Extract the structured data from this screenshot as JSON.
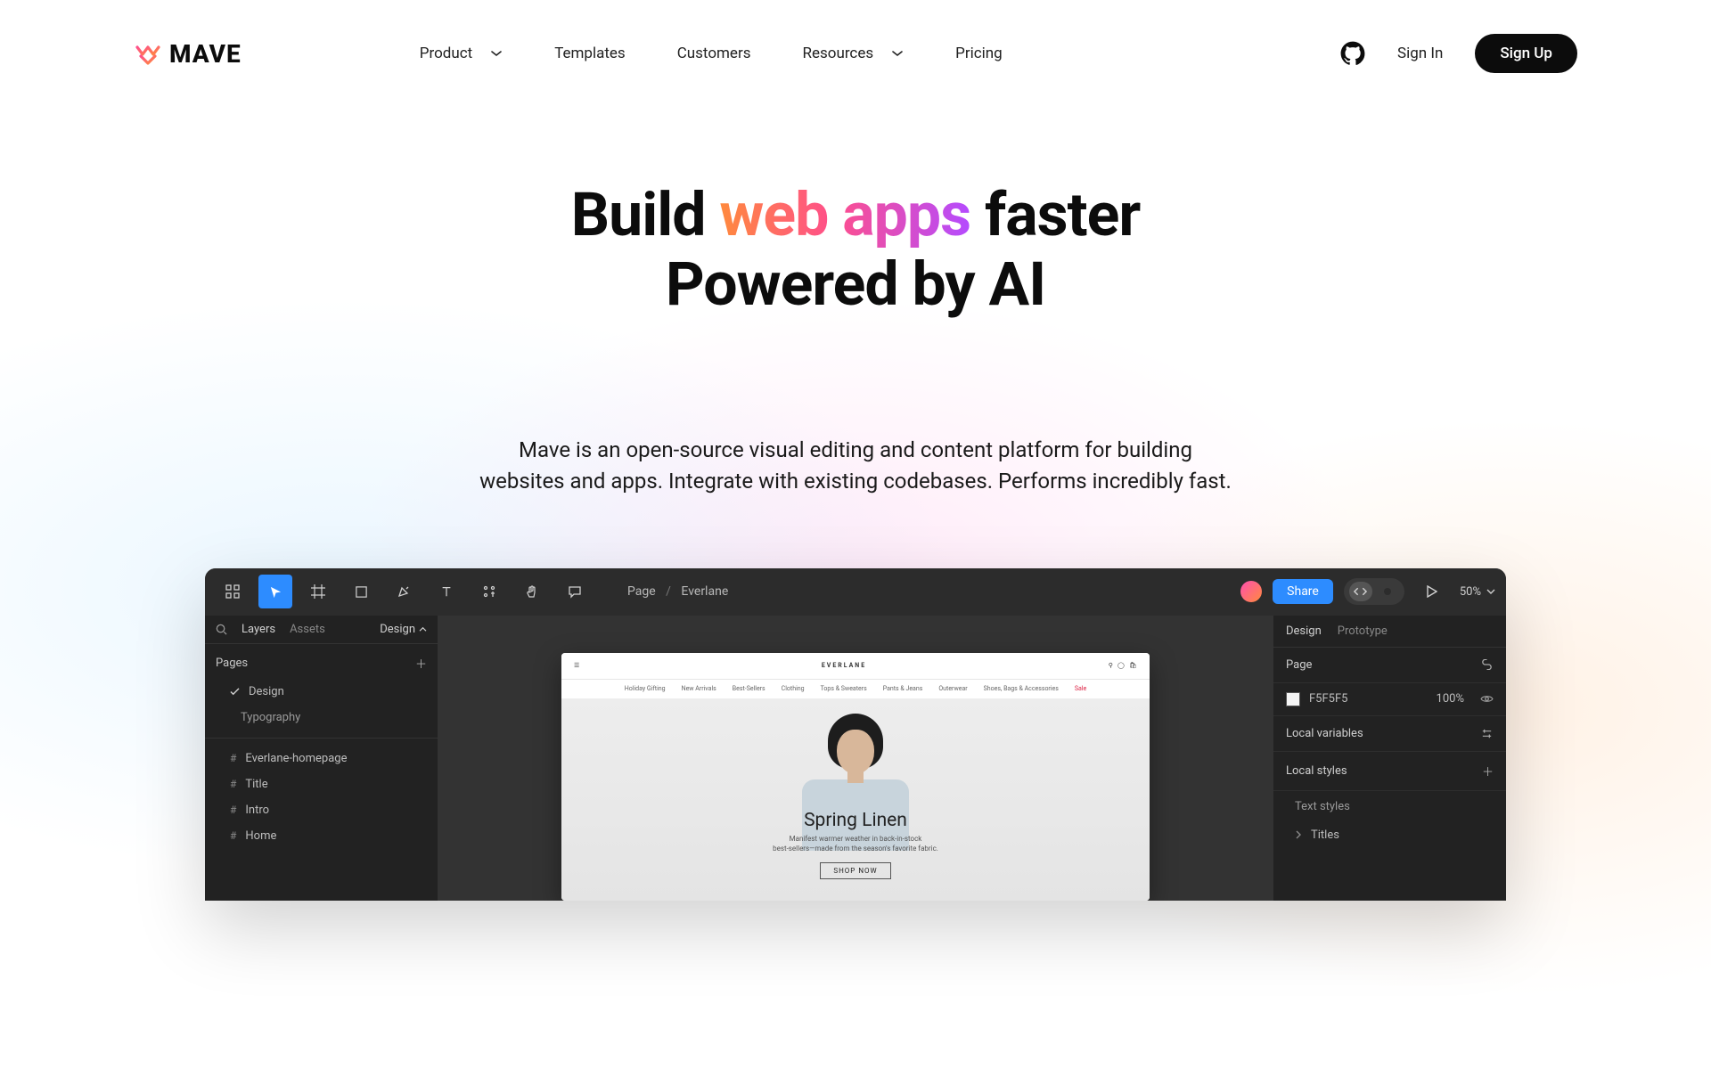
{
  "brand": {
    "name": "MAVE"
  },
  "nav": {
    "items": [
      {
        "label": "Product",
        "dropdown": true
      },
      {
        "label": "Templates",
        "dropdown": false
      },
      {
        "label": "Customers",
        "dropdown": false
      },
      {
        "label": "Resources",
        "dropdown": true
      },
      {
        "label": "Pricing",
        "dropdown": false
      }
    ],
    "signin": "Sign In",
    "signup": "Sign Up"
  },
  "hero": {
    "line1_before": "Build ",
    "line1_highlight": "web apps",
    "line1_after": " faster",
    "line2": "Powered by AI",
    "desc_l1": "Mave is an open-source visual editing and content platform for building",
    "desc_l2": "websites and apps. Integrate with existing codebases. Performs incredibly fast."
  },
  "editor": {
    "toolbar": {
      "crumb_root": "Page",
      "crumb_current": "Everlane",
      "share": "Share",
      "zoom": "50%"
    },
    "left": {
      "tab_layers": "Layers",
      "tab_assets": "Assets",
      "design_dd": "Design",
      "pages_header": "Pages",
      "pages": [
        {
          "label": "Design",
          "checked": true
        },
        {
          "label": "Typography"
        }
      ],
      "frames": [
        {
          "label": "Everlane-homepage"
        },
        {
          "label": "Title"
        },
        {
          "label": "Intro"
        },
        {
          "label": "Home"
        }
      ]
    },
    "canvas": {
      "brand": "EVERLANE",
      "title": "Spring Linen",
      "subtitle_l1": "Manifest warmer weather in back-in-stock",
      "subtitle_l2": "best-sellers—made from the season's favorite fabric.",
      "cta": "SHOP NOW",
      "subnav_sale": "Sale"
    },
    "right": {
      "tab_design": "Design",
      "tab_prototype": "Prototype",
      "page_header": "Page",
      "color_hex": "F5F5F5",
      "color_opacity": "100%",
      "local_vars": "Local variables",
      "local_styles": "Local styles",
      "text_styles": "Text styles",
      "titles": "Titles"
    }
  }
}
